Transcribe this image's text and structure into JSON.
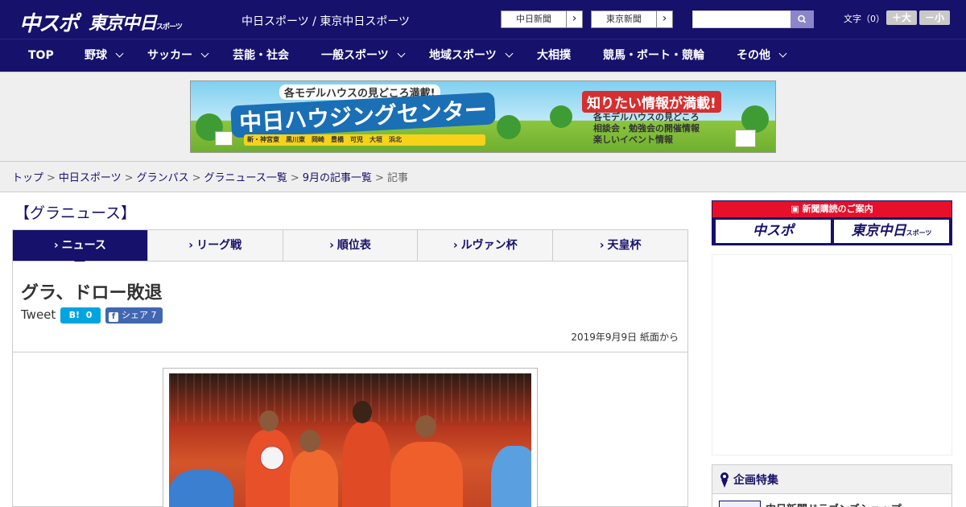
{
  "header": {
    "logo_chuspo": "中スポ",
    "logo_tokyo": "東京中日",
    "logo_tokyo_small": "スポーツ",
    "site_title": "中日スポーツ / 東京中日スポーツ",
    "paper_links": [
      {
        "label": "中日新聞",
        "arrow": "›"
      },
      {
        "label": "東京新聞",
        "arrow": "›"
      }
    ],
    "search": {
      "value": "",
      "placeholder": ""
    },
    "font_size_label": "文字（0）",
    "font_larger": "＋大",
    "font_smaller": "－小"
  },
  "nav": {
    "items": [
      {
        "label": "TOP",
        "dropdown": false
      },
      {
        "label": "野球",
        "dropdown": true
      },
      {
        "label": "サッカー",
        "dropdown": true
      },
      {
        "label": "芸能・社会",
        "dropdown": false
      },
      {
        "label": "一般スポーツ",
        "dropdown": true
      },
      {
        "label": "地域スポーツ",
        "dropdown": true
      },
      {
        "label": "大相撲",
        "dropdown": false
      },
      {
        "label": "競馬・ボート・競輪",
        "dropdown": false
      },
      {
        "label": "その他",
        "dropdown": true
      }
    ]
  },
  "banner": {
    "subtitle": "各モデルハウスの見どころ満載!",
    "title": "中日ハウジングセンター",
    "locations": "新・神宮東　黒川東　岡崎　豊橋　可児　大垣　浜北",
    "right_title": "知りたい情報が満載!",
    "right_items": [
      "各モデルハウスの見どころ",
      "相談会・勉強会の開催情報",
      "楽しいイベント情報"
    ]
  },
  "breadcrumb": {
    "items": [
      "トップ",
      "中日スポーツ",
      "グランパス",
      "グラニュース一覧",
      "9月の記事一覧"
    ],
    "current": "記事",
    "separator": ">"
  },
  "section_title": "【グラニュース】",
  "tabs": [
    {
      "label": "ニュース",
      "active": true
    },
    {
      "label": "リーグ戦",
      "active": false
    },
    {
      "label": "順位表",
      "active": false
    },
    {
      "label": "ルヴァン杯",
      "active": false
    },
    {
      "label": "天皇杯",
      "active": false
    }
  ],
  "tab_arrow": "›",
  "article": {
    "headline": "グラ、ドロー敗退",
    "tweet_label": "Tweet",
    "hatena_label": "B!",
    "hatena_count": "0",
    "fb_label": "シェア",
    "fb_count": "7",
    "fb_icon": "f",
    "date": "2019年9月9日 紙面から"
  },
  "sidebar": {
    "subscription_header": "新聞購読のご案内",
    "sub_chuspo": "中スポ",
    "sub_tokyo": "東京中日",
    "sub_tokyo_small": "スポーツ",
    "kikaku_title": "企画特集",
    "kikaku_item": "中日新聞ドラゴンズショップ"
  },
  "colors": {
    "brand_navy": "#16116b",
    "accent_red": "#e6102a",
    "hatena_blue": "#00a4de",
    "facebook_blue": "#4267b2"
  }
}
